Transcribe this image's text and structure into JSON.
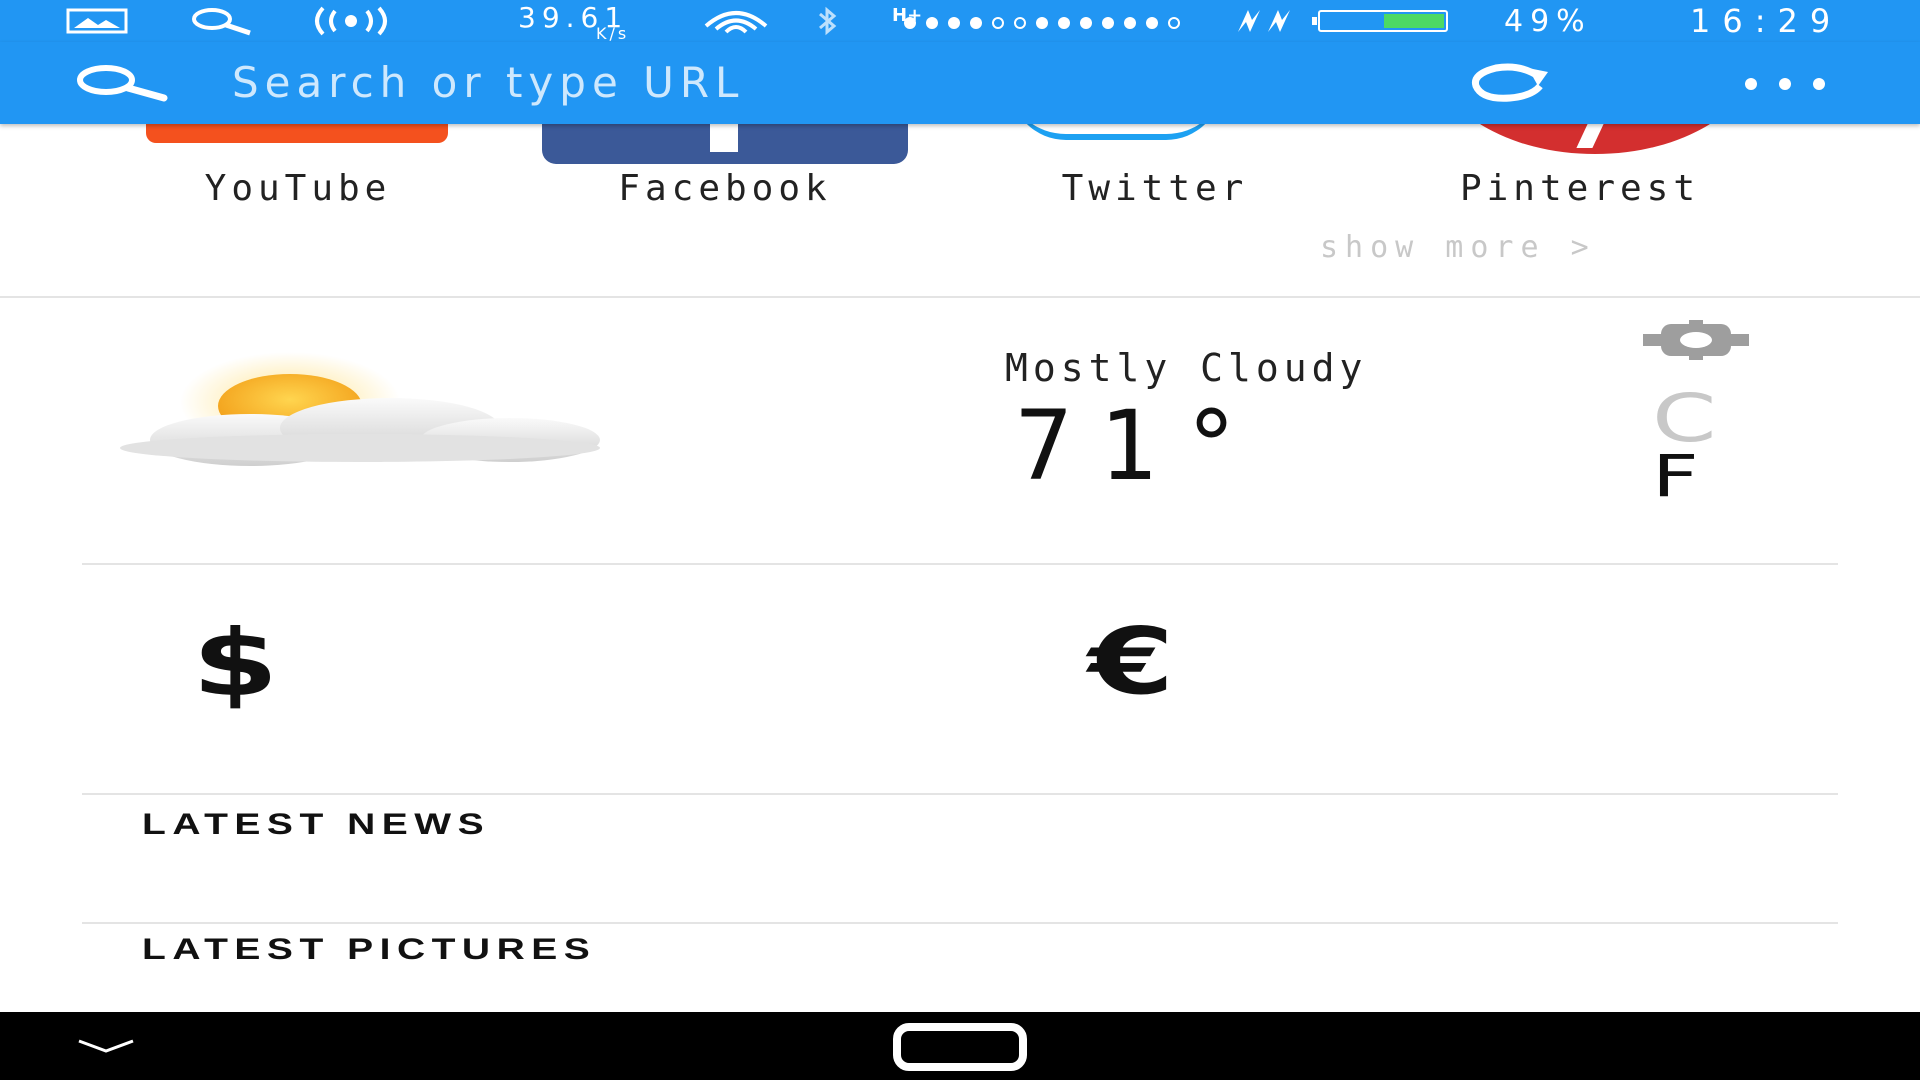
{
  "status_bar": {
    "speed_value": "39.61",
    "speed_unit": "K/s",
    "network": "H+",
    "battery_percent": "49%",
    "battery_level": 0.49,
    "time": "16:29",
    "icons": [
      "image-icon",
      "search-icon",
      "hotspot-icon",
      "wifi-icon",
      "bluetooth-icon",
      "signal-icon",
      "charging-icon",
      "battery-icon"
    ]
  },
  "address_bar": {
    "placeholder": "Search or type URL",
    "icons": [
      "search-icon",
      "refresh-icon",
      "more-icon"
    ]
  },
  "shortcuts": {
    "items": [
      {
        "label": "YouTube",
        "color": "#f4511e"
      },
      {
        "label": "Facebook",
        "color": "#3b5998"
      },
      {
        "label": "Twitter",
        "color": "#1da1f2"
      },
      {
        "label": "Pinterest",
        "color": "#d32f2f"
      }
    ],
    "show_more": "show more >"
  },
  "weather": {
    "condition": "Mostly Cloudy",
    "temperature": "71°",
    "unit_c": "C",
    "unit_f": "F",
    "icons": [
      "partly-cloudy-icon",
      "gear-icon"
    ]
  },
  "currency": {
    "dollar": "$",
    "euro": "€"
  },
  "sections": {
    "latest_news": "LATEST NEWS",
    "latest_pictures": "LATEST PICTURES"
  },
  "nav_bar": {
    "icons": [
      "chevron-down-icon",
      "home-icon"
    ]
  }
}
